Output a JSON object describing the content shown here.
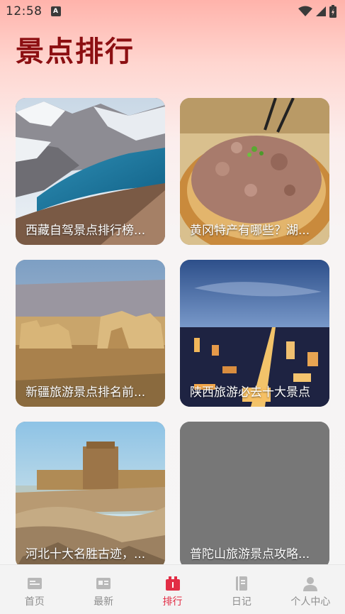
{
  "status": {
    "time": "12:58"
  },
  "title": "景点排行",
  "cards": [
    {
      "title": "西藏自驾景点排行榜...",
      "image": "snowy-mountain-lake"
    },
    {
      "title": "黄冈特产有哪些？湖...",
      "image": "steamed-meat-dish"
    },
    {
      "title": "新疆旅游景点排名前...",
      "image": "desert-ruins"
    },
    {
      "title": "陕西旅游必去十大景点",
      "image": "city-night-view"
    },
    {
      "title": "河北十大名胜古迹，...",
      "image": "coastal-great-wall"
    },
    {
      "title": "普陀山旅游景点攻略...",
      "image": "placeholder"
    }
  ],
  "tabs": [
    {
      "label": "首页",
      "icon": "home-icon",
      "active": false
    },
    {
      "label": "最新",
      "icon": "news-icon",
      "active": false
    },
    {
      "label": "排行",
      "icon": "ranking-icon",
      "active": true
    },
    {
      "label": "日记",
      "icon": "diary-icon",
      "active": false
    },
    {
      "label": "个人中心",
      "icon": "profile-icon",
      "active": false
    }
  ],
  "colors": {
    "accent": "#e22d45",
    "title": "#8c0f12",
    "inactive": "#8e8e8e"
  }
}
